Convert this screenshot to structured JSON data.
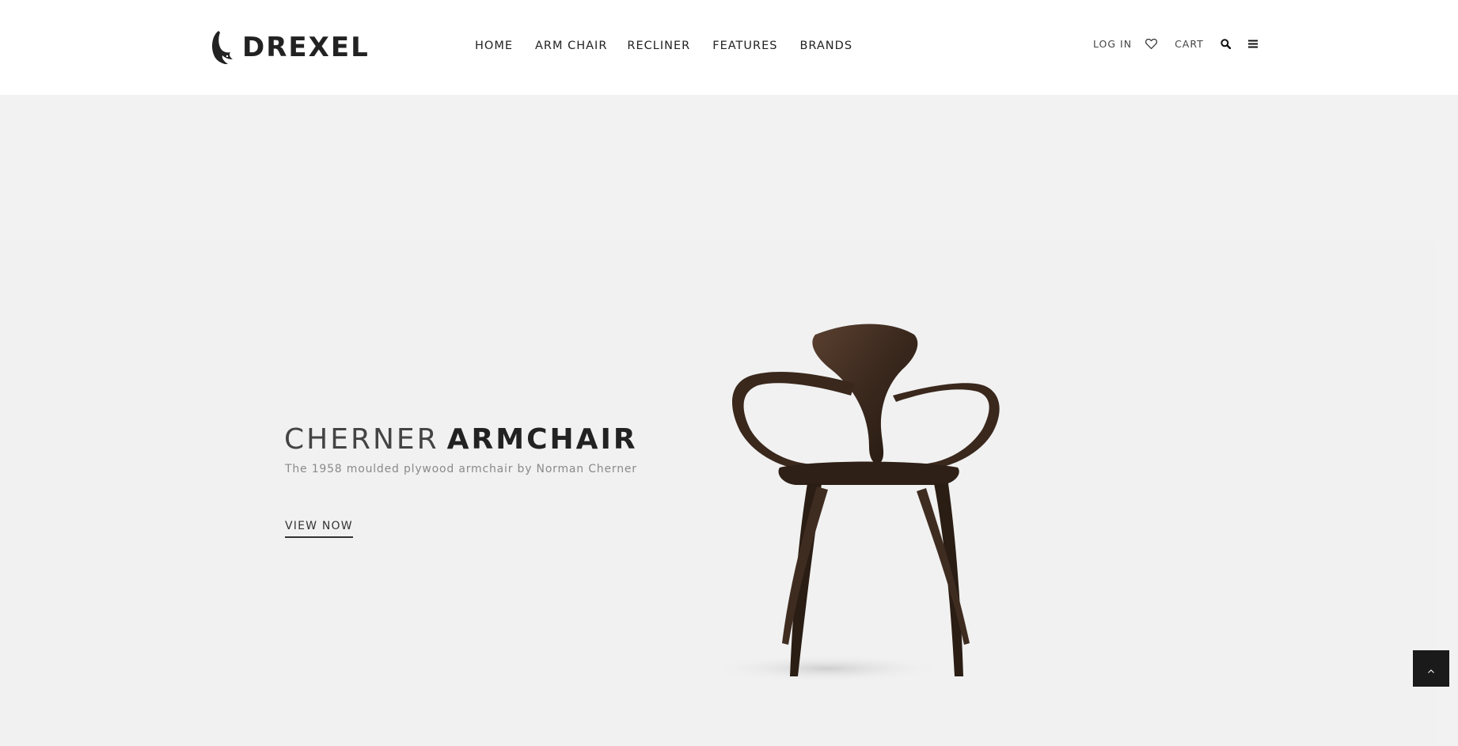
{
  "brand": {
    "name": "DREXEL",
    "logo_icon": "cat-logo-icon"
  },
  "nav": {
    "items": [
      {
        "label": "HOME"
      },
      {
        "label": "ARM CHAIR"
      },
      {
        "label": "RECLINER"
      },
      {
        "label": "FEATURES"
      },
      {
        "label": "BRANDS"
      }
    ]
  },
  "utility": {
    "login_label": "LOG IN",
    "wishlist_icon": "heart-icon",
    "cart_label": "CART",
    "search_icon": "search-icon",
    "menu_icon": "hamburger-menu-icon"
  },
  "hero": {
    "title_light": "CHERNER",
    "title_bold": "ARMCHAIR",
    "subtitle": "The 1958 moulded plywood armchair by Norman Cherner",
    "cta_label": "VIEW NOW",
    "image": "cherner-armchair-image"
  },
  "back_to_top": {
    "icon": "chevron-up-icon"
  },
  "colors": {
    "header_bg": "#ffffff",
    "hero_bg": "#f2f2f2",
    "text_dark": "#222222",
    "subtitle": "#8a8a8a",
    "button_dark": "#1a1a1a",
    "wood": "#3b2a20"
  }
}
